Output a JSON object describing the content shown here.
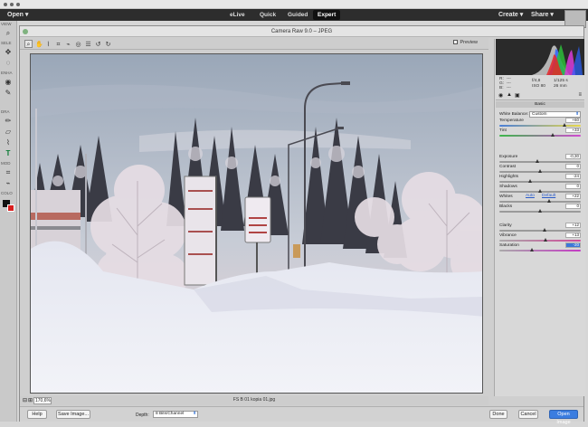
{
  "app_bar": {
    "open_label": "Open",
    "modes": [
      "eLive",
      "Quick",
      "Guided",
      "Expert"
    ],
    "active_mode": "Expert",
    "create_label": "Create",
    "share_label": "Share"
  },
  "toolbar": {
    "labels": [
      "VIEW",
      "SELE",
      "ENHA",
      "DRA",
      "MOD",
      "COLO"
    ]
  },
  "dialog": {
    "title": "Camera Raw 9.0  –  JPEG",
    "preview_label": "Preview",
    "zoom": "170,6%",
    "filename": "FS B 01 kopia 01.jpg"
  },
  "readout": {
    "r_label": "R:",
    "g_label": "G:",
    "b_label": "B:",
    "r_value": "---",
    "g_value": "---",
    "b_value": "---",
    "aperture": "f/4,8",
    "shutter": "1/125 s",
    "iso": "ISO 80",
    "focal": "26 mm"
  },
  "basic_panel": {
    "header": "Basic",
    "white_balance_label": "White Balance:",
    "white_balance_value": "Custom",
    "auto_label": "Auto",
    "default_label": "Default",
    "sliders": [
      {
        "label": "Temperature",
        "value": "+60",
        "pos": 0.8
      },
      {
        "label": "Tint",
        "value": "+33",
        "pos": 0.66
      },
      {
        "label": "Exposure",
        "value": "-0,30",
        "pos": 0.47
      },
      {
        "label": "Contrast",
        "value": "0",
        "pos": 0.5
      },
      {
        "label": "Highlights",
        "value": "-24",
        "pos": 0.38
      },
      {
        "label": "Shadows",
        "value": "0",
        "pos": 0.5
      },
      {
        "label": "Whites",
        "value": "+22",
        "pos": 0.61
      },
      {
        "label": "Blacks",
        "value": "0",
        "pos": 0.5
      },
      {
        "label": "Clarity",
        "value": "+12",
        "pos": 0.56
      },
      {
        "label": "Vibrance",
        "value": "+13",
        "pos": 0.57
      },
      {
        "label": "Saturation",
        "value": "-20",
        "pos": 0.4
      }
    ]
  },
  "footer": {
    "help_label": "Help",
    "save_label": "Save Image...",
    "depth_label": "Depth:",
    "depth_value": "8 Bits/Channel",
    "done_label": "Done",
    "cancel_label": "Cancel",
    "open_image_label": "Open Image"
  },
  "colors": {
    "accent": "#3b7de0",
    "menubar": "#2d2d2d"
  }
}
